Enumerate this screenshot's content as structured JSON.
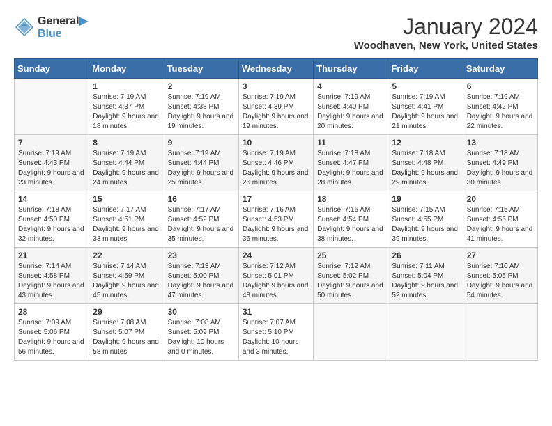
{
  "header": {
    "logo_line1": "General",
    "logo_line2": "Blue",
    "month_title": "January 2024",
    "location": "Woodhaven, New York, United States"
  },
  "weekdays": [
    "Sunday",
    "Monday",
    "Tuesday",
    "Wednesday",
    "Thursday",
    "Friday",
    "Saturday"
  ],
  "weeks": [
    [
      {
        "day": "",
        "sunrise": "",
        "sunset": "",
        "daylight": ""
      },
      {
        "day": "1",
        "sunrise": "Sunrise: 7:19 AM",
        "sunset": "Sunset: 4:37 PM",
        "daylight": "Daylight: 9 hours and 18 minutes."
      },
      {
        "day": "2",
        "sunrise": "Sunrise: 7:19 AM",
        "sunset": "Sunset: 4:38 PM",
        "daylight": "Daylight: 9 hours and 19 minutes."
      },
      {
        "day": "3",
        "sunrise": "Sunrise: 7:19 AM",
        "sunset": "Sunset: 4:39 PM",
        "daylight": "Daylight: 9 hours and 19 minutes."
      },
      {
        "day": "4",
        "sunrise": "Sunrise: 7:19 AM",
        "sunset": "Sunset: 4:40 PM",
        "daylight": "Daylight: 9 hours and 20 minutes."
      },
      {
        "day": "5",
        "sunrise": "Sunrise: 7:19 AM",
        "sunset": "Sunset: 4:41 PM",
        "daylight": "Daylight: 9 hours and 21 minutes."
      },
      {
        "day": "6",
        "sunrise": "Sunrise: 7:19 AM",
        "sunset": "Sunset: 4:42 PM",
        "daylight": "Daylight: 9 hours and 22 minutes."
      }
    ],
    [
      {
        "day": "7",
        "sunrise": "Sunrise: 7:19 AM",
        "sunset": "Sunset: 4:43 PM",
        "daylight": "Daylight: 9 hours and 23 minutes."
      },
      {
        "day": "8",
        "sunrise": "Sunrise: 7:19 AM",
        "sunset": "Sunset: 4:44 PM",
        "daylight": "Daylight: 9 hours and 24 minutes."
      },
      {
        "day": "9",
        "sunrise": "Sunrise: 7:19 AM",
        "sunset": "Sunset: 4:44 PM",
        "daylight": "Daylight: 9 hours and 25 minutes."
      },
      {
        "day": "10",
        "sunrise": "Sunrise: 7:19 AM",
        "sunset": "Sunset: 4:46 PM",
        "daylight": "Daylight: 9 hours and 26 minutes."
      },
      {
        "day": "11",
        "sunrise": "Sunrise: 7:18 AM",
        "sunset": "Sunset: 4:47 PM",
        "daylight": "Daylight: 9 hours and 28 minutes."
      },
      {
        "day": "12",
        "sunrise": "Sunrise: 7:18 AM",
        "sunset": "Sunset: 4:48 PM",
        "daylight": "Daylight: 9 hours and 29 minutes."
      },
      {
        "day": "13",
        "sunrise": "Sunrise: 7:18 AM",
        "sunset": "Sunset: 4:49 PM",
        "daylight": "Daylight: 9 hours and 30 minutes."
      }
    ],
    [
      {
        "day": "14",
        "sunrise": "Sunrise: 7:18 AM",
        "sunset": "Sunset: 4:50 PM",
        "daylight": "Daylight: 9 hours and 32 minutes."
      },
      {
        "day": "15",
        "sunrise": "Sunrise: 7:17 AM",
        "sunset": "Sunset: 4:51 PM",
        "daylight": "Daylight: 9 hours and 33 minutes."
      },
      {
        "day": "16",
        "sunrise": "Sunrise: 7:17 AM",
        "sunset": "Sunset: 4:52 PM",
        "daylight": "Daylight: 9 hours and 35 minutes."
      },
      {
        "day": "17",
        "sunrise": "Sunrise: 7:16 AM",
        "sunset": "Sunset: 4:53 PM",
        "daylight": "Daylight: 9 hours and 36 minutes."
      },
      {
        "day": "18",
        "sunrise": "Sunrise: 7:16 AM",
        "sunset": "Sunset: 4:54 PM",
        "daylight": "Daylight: 9 hours and 38 minutes."
      },
      {
        "day": "19",
        "sunrise": "Sunrise: 7:15 AM",
        "sunset": "Sunset: 4:55 PM",
        "daylight": "Daylight: 9 hours and 39 minutes."
      },
      {
        "day": "20",
        "sunrise": "Sunrise: 7:15 AM",
        "sunset": "Sunset: 4:56 PM",
        "daylight": "Daylight: 9 hours and 41 minutes."
      }
    ],
    [
      {
        "day": "21",
        "sunrise": "Sunrise: 7:14 AM",
        "sunset": "Sunset: 4:58 PM",
        "daylight": "Daylight: 9 hours and 43 minutes."
      },
      {
        "day": "22",
        "sunrise": "Sunrise: 7:14 AM",
        "sunset": "Sunset: 4:59 PM",
        "daylight": "Daylight: 9 hours and 45 minutes."
      },
      {
        "day": "23",
        "sunrise": "Sunrise: 7:13 AM",
        "sunset": "Sunset: 5:00 PM",
        "daylight": "Daylight: 9 hours and 47 minutes."
      },
      {
        "day": "24",
        "sunrise": "Sunrise: 7:12 AM",
        "sunset": "Sunset: 5:01 PM",
        "daylight": "Daylight: 9 hours and 48 minutes."
      },
      {
        "day": "25",
        "sunrise": "Sunrise: 7:12 AM",
        "sunset": "Sunset: 5:02 PM",
        "daylight": "Daylight: 9 hours and 50 minutes."
      },
      {
        "day": "26",
        "sunrise": "Sunrise: 7:11 AM",
        "sunset": "Sunset: 5:04 PM",
        "daylight": "Daylight: 9 hours and 52 minutes."
      },
      {
        "day": "27",
        "sunrise": "Sunrise: 7:10 AM",
        "sunset": "Sunset: 5:05 PM",
        "daylight": "Daylight: 9 hours and 54 minutes."
      }
    ],
    [
      {
        "day": "28",
        "sunrise": "Sunrise: 7:09 AM",
        "sunset": "Sunset: 5:06 PM",
        "daylight": "Daylight: 9 hours and 56 minutes."
      },
      {
        "day": "29",
        "sunrise": "Sunrise: 7:08 AM",
        "sunset": "Sunset: 5:07 PM",
        "daylight": "Daylight: 9 hours and 58 minutes."
      },
      {
        "day": "30",
        "sunrise": "Sunrise: 7:08 AM",
        "sunset": "Sunset: 5:09 PM",
        "daylight": "Daylight: 10 hours and 0 minutes."
      },
      {
        "day": "31",
        "sunrise": "Sunrise: 7:07 AM",
        "sunset": "Sunset: 5:10 PM",
        "daylight": "Daylight: 10 hours and 3 minutes."
      },
      {
        "day": "",
        "sunrise": "",
        "sunset": "",
        "daylight": ""
      },
      {
        "day": "",
        "sunrise": "",
        "sunset": "",
        "daylight": ""
      },
      {
        "day": "",
        "sunrise": "",
        "sunset": "",
        "daylight": ""
      }
    ]
  ]
}
